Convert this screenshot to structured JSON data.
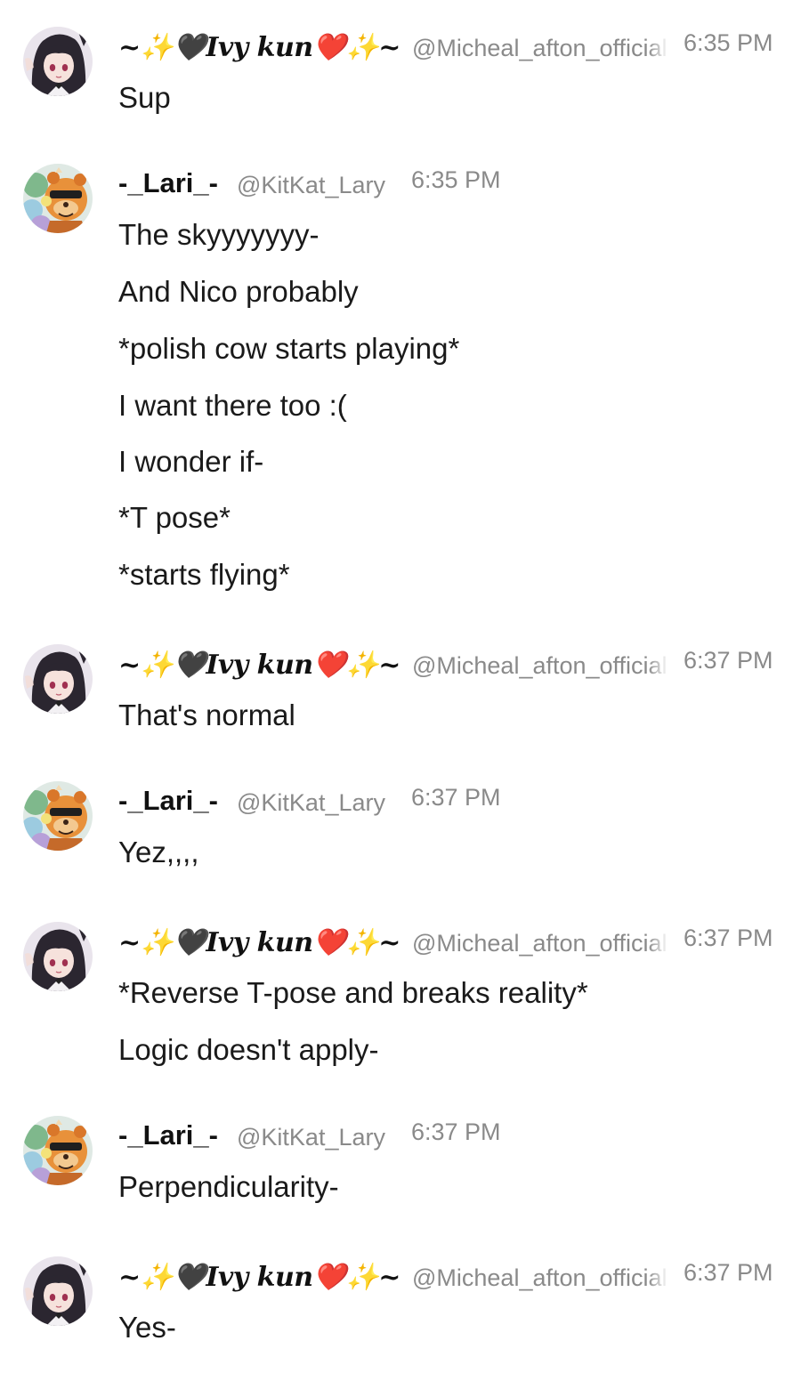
{
  "users": {
    "ivy": {
      "display_name": "~✨🖤Ivy kun❤️✨~",
      "handle": "@Micheal_afton_official",
      "avatar_icon": "anime-girl-avatar-icon"
    },
    "lari": {
      "display_name": "-_Lari_-",
      "handle": "@KitKat_Lary",
      "avatar_icon": "animatronic-bear-avatar-icon"
    }
  },
  "messages": [
    {
      "author": "ivy",
      "time": "6:35 PM",
      "lines": [
        "Sup"
      ]
    },
    {
      "author": "lari",
      "time": "6:35 PM",
      "lines": [
        "The skyyyyyyy-",
        "And Nico probably",
        "*polish cow starts playing*",
        "I want there too :(",
        "I wonder if-",
        "*T pose*",
        "*starts flying*"
      ]
    },
    {
      "author": "ivy",
      "time": "6:37 PM",
      "lines": [
        "That's normal"
      ]
    },
    {
      "author": "lari",
      "time": "6:37 PM",
      "lines": [
        "Yez,,,,"
      ]
    },
    {
      "author": "ivy",
      "time": "6:37 PM",
      "lines": [
        "*Reverse T-pose and breaks reality*",
        "Logic doesn't apply-"
      ]
    },
    {
      "author": "lari",
      "time": "6:37 PM",
      "lines": [
        "Perpendicularity-"
      ]
    },
    {
      "author": "ivy",
      "time": "6:37 PM",
      "lines": [
        "Yes-"
      ]
    }
  ]
}
